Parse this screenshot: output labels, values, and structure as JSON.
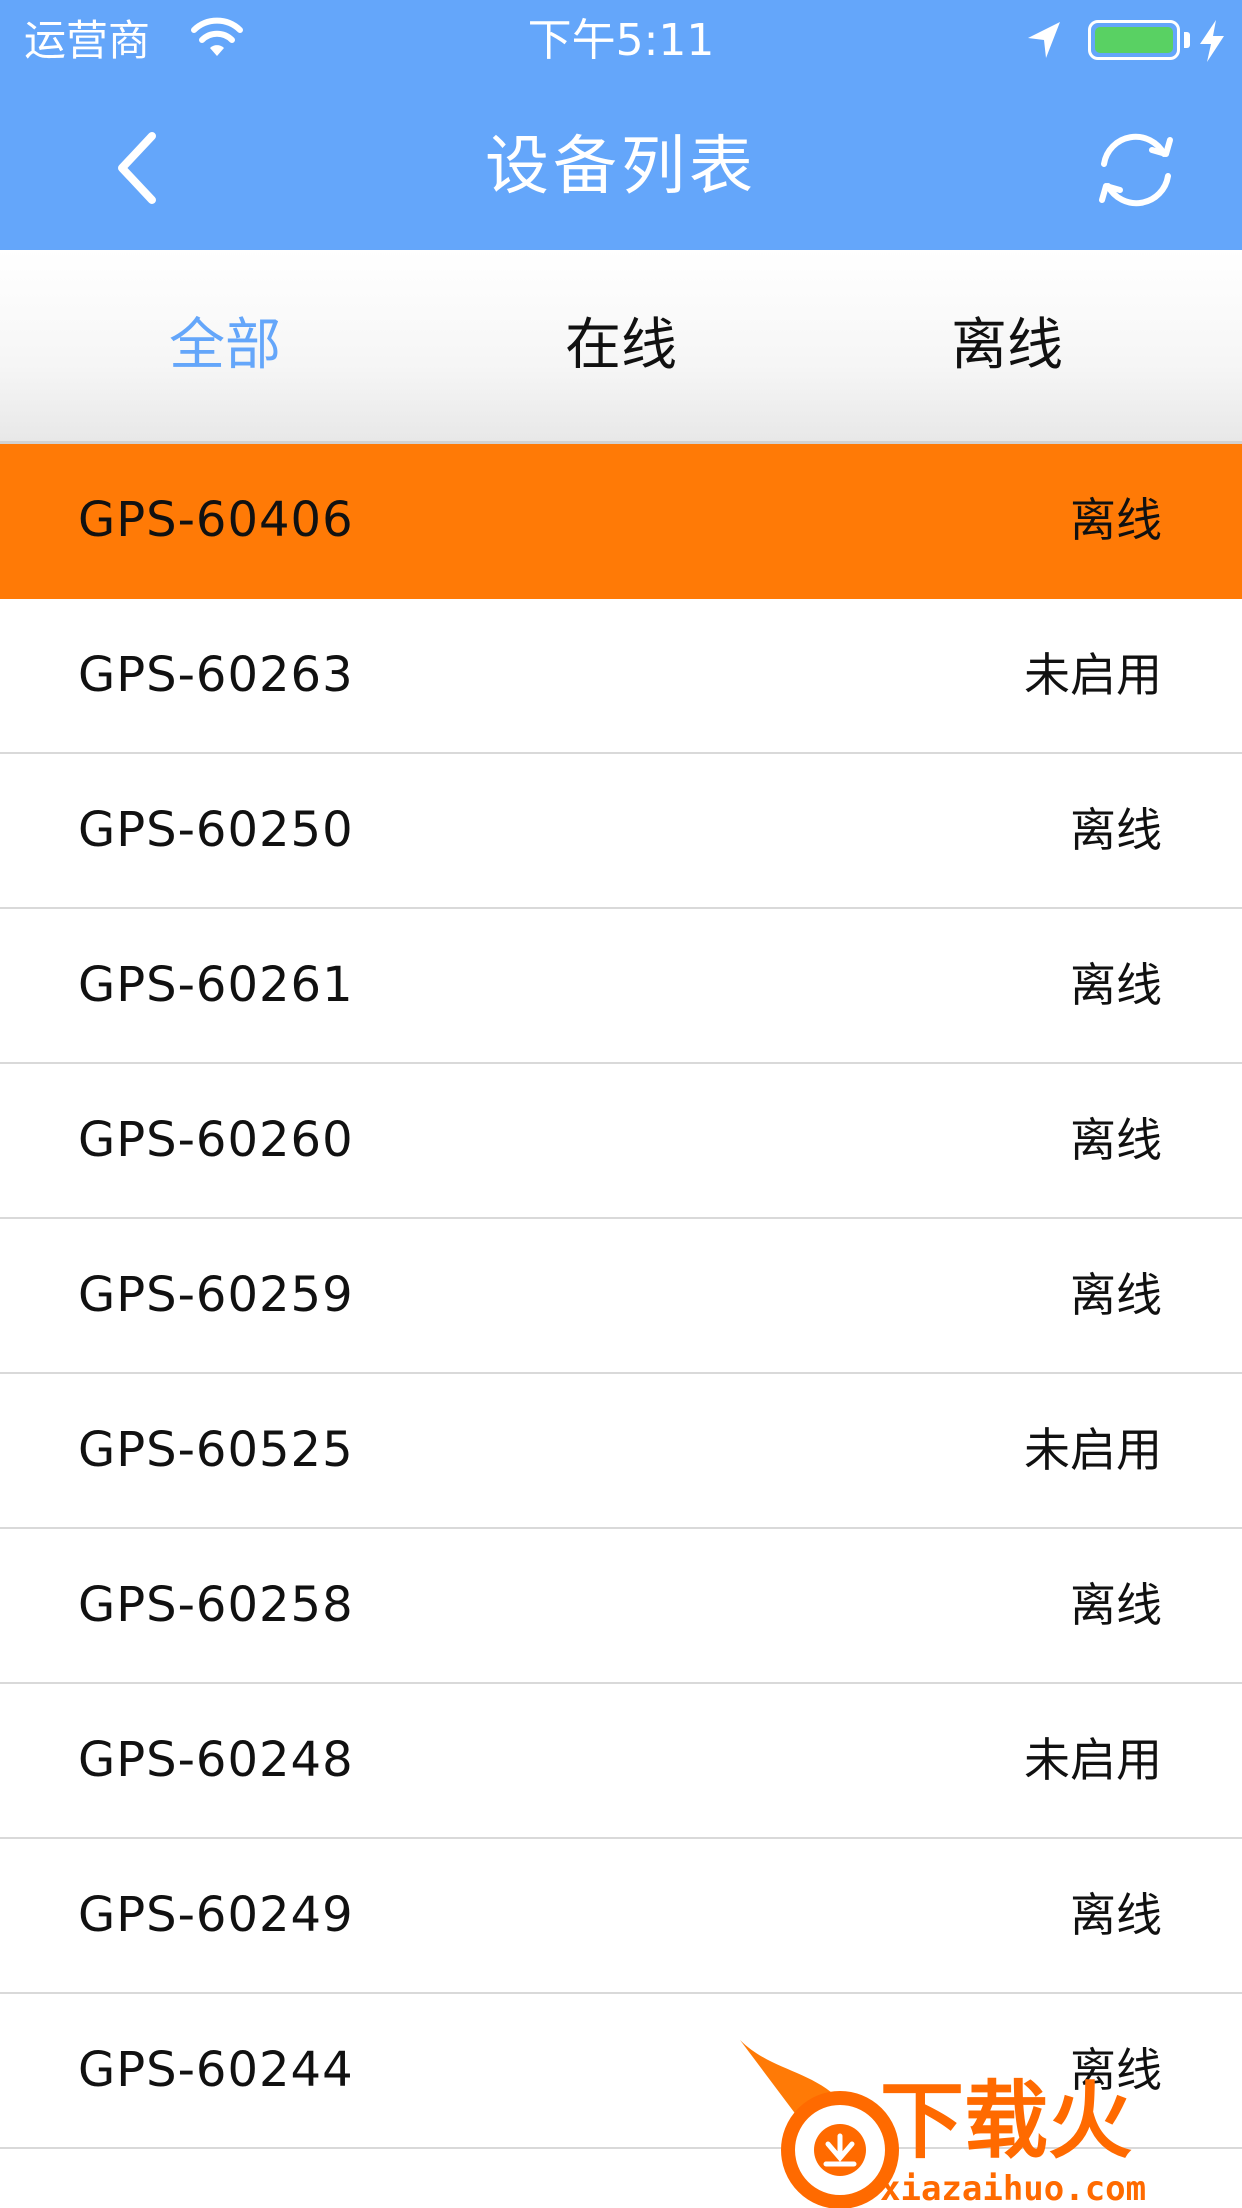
{
  "status_bar": {
    "carrier": "运营商",
    "time": "下午5:11",
    "battery_level": 1.0,
    "battery_color": "#59d163"
  },
  "nav": {
    "title": "设备列表",
    "back_icon": "chevron-left-icon",
    "refresh_icon": "refresh-icon",
    "background": "#64a6fa"
  },
  "tabs": [
    {
      "label": "全部",
      "active": true
    },
    {
      "label": "在线",
      "active": false
    },
    {
      "label": "离线",
      "active": false
    }
  ],
  "devices": [
    {
      "name": "GPS-60406",
      "status": "离线",
      "selected": true
    },
    {
      "name": "GPS-60263",
      "status": "未启用"
    },
    {
      "name": "GPS-60250",
      "status": "离线"
    },
    {
      "name": "GPS-60261",
      "status": "离线"
    },
    {
      "name": "GPS-60260",
      "status": "离线"
    },
    {
      "name": "GPS-60259",
      "status": "离线"
    },
    {
      "name": "GPS-60525",
      "status": "未启用"
    },
    {
      "name": "GPS-60258",
      "status": "离线"
    },
    {
      "name": "GPS-60248",
      "status": "未启用"
    },
    {
      "name": "GPS-60249",
      "status": "离线"
    },
    {
      "name": "GPS-60244",
      "status": "离线"
    }
  ],
  "colors": {
    "accent": "#64a6fa",
    "selected_row": "#ff7a06"
  },
  "watermark": {
    "brand": "下载火",
    "domain": "xiazaihuo.com"
  }
}
